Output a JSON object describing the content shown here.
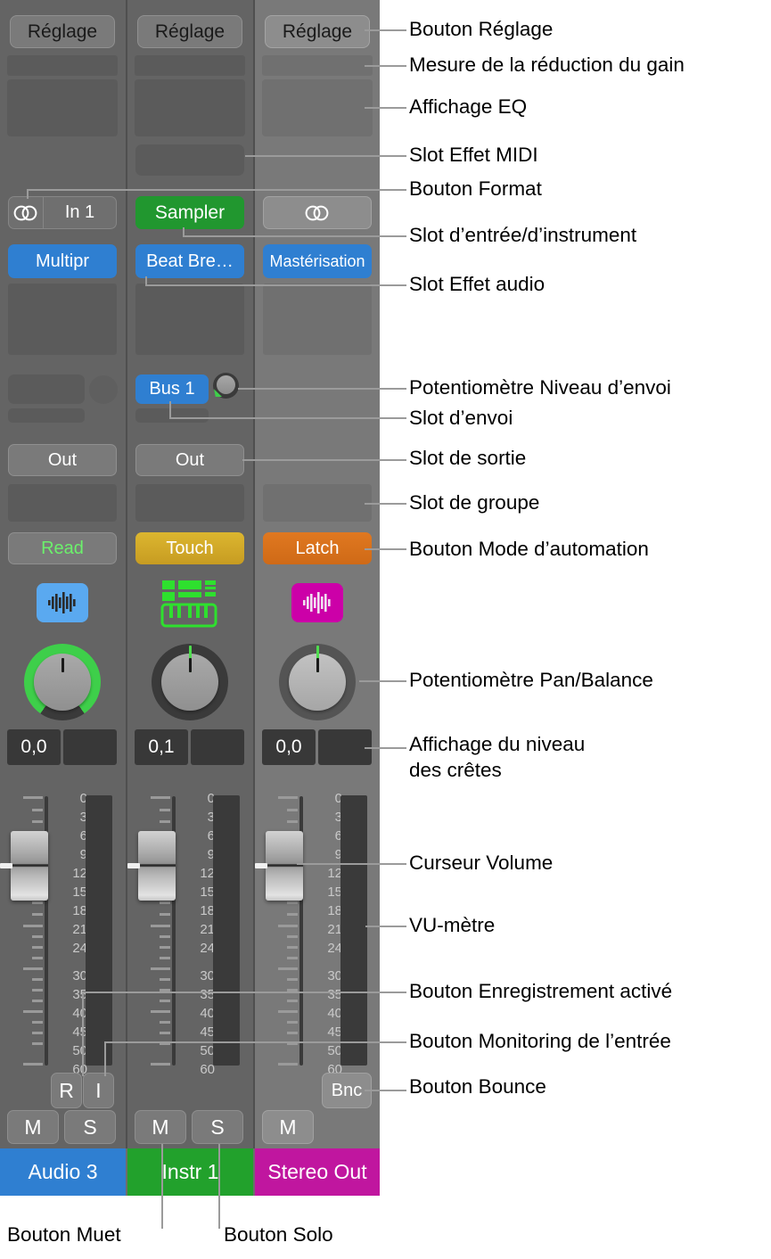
{
  "mixer": {
    "channels": [
      {
        "name": "Audio 3",
        "name_color": "#2f7fd1",
        "setting_label": "Réglage",
        "format_icon": "stereo-circles-icon",
        "input_label": "In 1",
        "audio_fx_label": "Multipr",
        "output_label": "Out",
        "automation_mode": "Read",
        "track_icon": "audio-waveform-icon",
        "peak_value": "0,0",
        "record_label": "R",
        "input_monitor_label": "I",
        "mute_label": "M",
        "solo_label": "S"
      },
      {
        "name": "Instr 1",
        "name_color": "#22a12c",
        "setting_label": "Réglage",
        "instrument_label": "Sampler",
        "audio_fx_label": "Beat Bre…",
        "send_label": "Bus 1",
        "output_label": "Out",
        "automation_mode": "Touch",
        "track_icon": "midi-region-keyboard-icon",
        "peak_value": "0,1",
        "mute_label": "M",
        "solo_label": "S"
      },
      {
        "name": "Stereo Out",
        "name_color": "#c0169f",
        "setting_label": "Réglage",
        "format_icon": "stereo-circles-icon",
        "audio_fx_label": "Mastérisation",
        "automation_mode": "Latch",
        "track_icon": "audio-waveform-icon",
        "peak_value": "0,0",
        "bounce_label": "Bnc",
        "mute_label": "M"
      }
    ],
    "meter_scale": [
      "0",
      "3",
      "6",
      "9",
      "12",
      "15",
      "18",
      "21",
      "24",
      "30",
      "35",
      "40",
      "45",
      "50",
      "60"
    ]
  },
  "annotations": [
    {
      "id": "setting-button",
      "text": "Bouton Réglage"
    },
    {
      "id": "gain-reduction-meter",
      "text": "Mesure de la réduction du gain"
    },
    {
      "id": "eq-display",
      "text": "Affichage EQ"
    },
    {
      "id": "midi-effect-slot",
      "text": "Slot Effet MIDI"
    },
    {
      "id": "format-button",
      "text": "Bouton Format"
    },
    {
      "id": "input-instrument-slot",
      "text": "Slot d’entrée/d’instrument"
    },
    {
      "id": "audio-effect-slot",
      "text": "Slot Effet audio"
    },
    {
      "id": "send-level-knob",
      "text": "Potentiomètre Niveau d’envoi"
    },
    {
      "id": "send-slot",
      "text": "Slot d’envoi"
    },
    {
      "id": "output-slot",
      "text": "Slot de sortie"
    },
    {
      "id": "group-slot",
      "text": "Slot de groupe"
    },
    {
      "id": "automation-mode-button",
      "text": "Bouton Mode d’automation"
    },
    {
      "id": "pan-balance-knob",
      "text": "Potentiomètre Pan/Balance"
    },
    {
      "id": "peak-level-display",
      "text": "Affichage du niveau\ndes crêtes"
    },
    {
      "id": "volume-slider",
      "text": "Curseur Volume"
    },
    {
      "id": "vu-meter",
      "text": "VU-mètre"
    },
    {
      "id": "record-enable-button",
      "text": "Bouton Enregistrement activé"
    },
    {
      "id": "input-monitoring-button",
      "text": "Bouton Monitoring de l’entrée"
    },
    {
      "id": "bounce-button",
      "text": "Bouton Bounce"
    },
    {
      "id": "mute-button",
      "text": "Bouton Muet"
    },
    {
      "id": "solo-button",
      "text": "Bouton Solo"
    }
  ]
}
